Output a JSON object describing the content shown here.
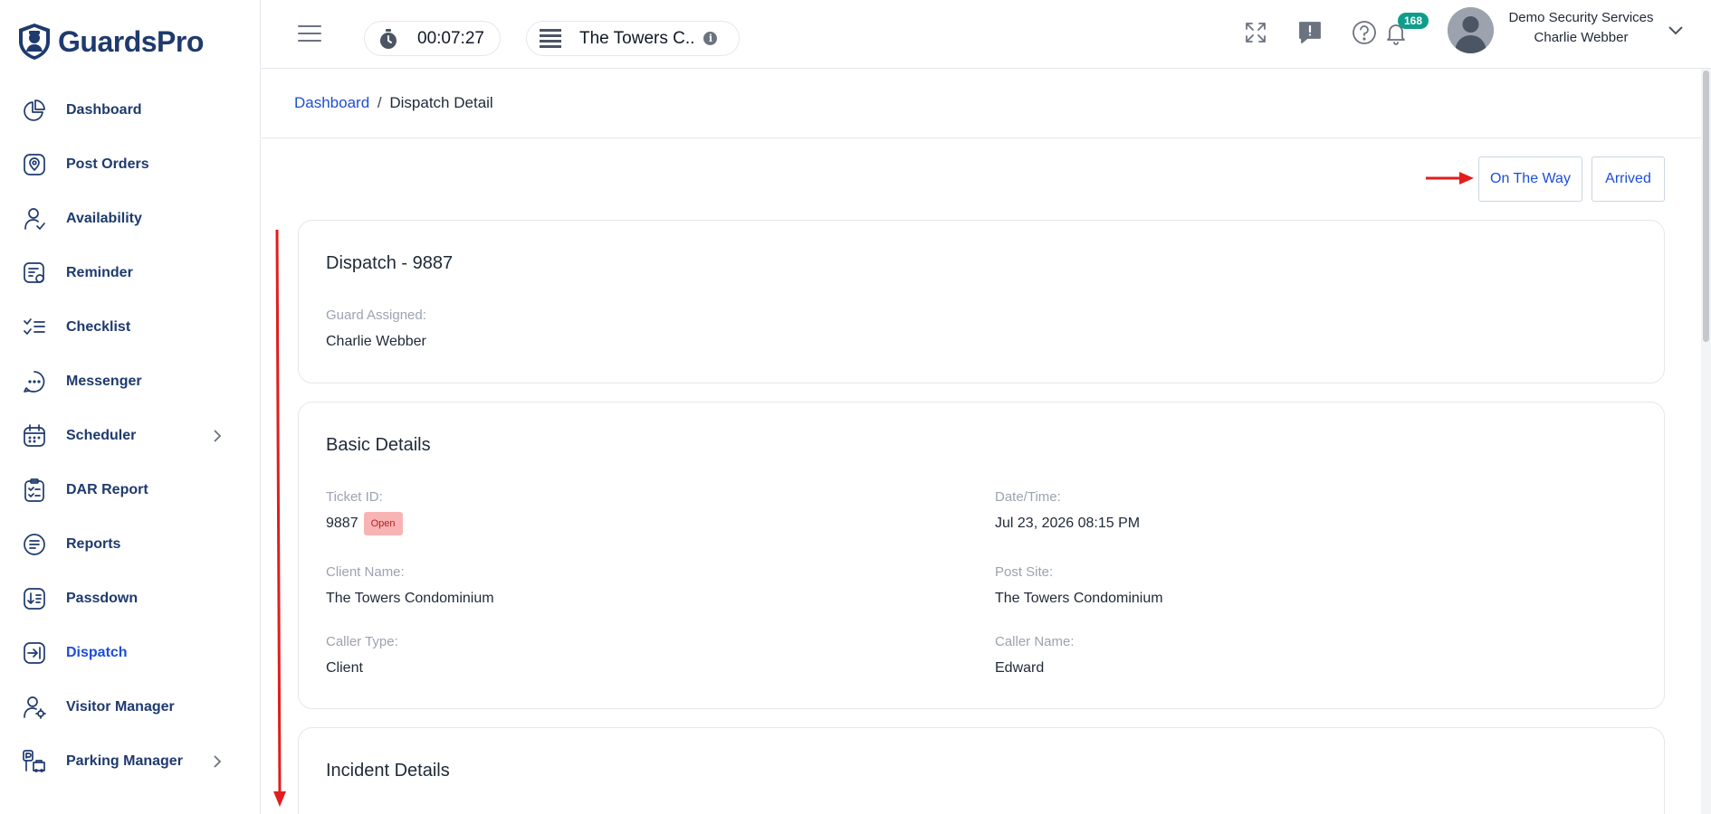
{
  "brand": {
    "name": "GuardsPro"
  },
  "sidebar": {
    "items": [
      {
        "label": "Dashboard",
        "icon": "pie-chart-icon",
        "active": false,
        "submenu": false
      },
      {
        "label": "Post Orders",
        "icon": "location-pin-icon",
        "active": false,
        "submenu": false
      },
      {
        "label": "Availability",
        "icon": "user-check-icon",
        "active": false,
        "submenu": false
      },
      {
        "label": "Reminder",
        "icon": "reminder-icon",
        "active": false,
        "submenu": false
      },
      {
        "label": "Checklist",
        "icon": "checklist-icon",
        "active": false,
        "submenu": false
      },
      {
        "label": "Messenger",
        "icon": "chat-icon",
        "active": false,
        "submenu": false
      },
      {
        "label": "Scheduler",
        "icon": "calendar-icon",
        "active": false,
        "submenu": true
      },
      {
        "label": "DAR Report",
        "icon": "clipboard-icon",
        "active": false,
        "submenu": false
      },
      {
        "label": "Reports",
        "icon": "report-icon",
        "active": false,
        "submenu": false
      },
      {
        "label": "Passdown",
        "icon": "passdown-icon",
        "active": false,
        "submenu": false
      },
      {
        "label": "Dispatch",
        "icon": "dispatch-icon",
        "active": true,
        "submenu": false
      },
      {
        "label": "Visitor Manager",
        "icon": "visitor-icon",
        "active": false,
        "submenu": false
      },
      {
        "label": "Parking Manager",
        "icon": "parking-icon",
        "active": false,
        "submenu": true
      }
    ]
  },
  "topbar": {
    "timer": "00:07:27",
    "site": "The Towers C..",
    "notifications_count": "168",
    "user_company": "Demo Security Services",
    "user_name": "Charlie Webber"
  },
  "breadcrumb": {
    "home": "Dashboard",
    "separator": "/",
    "current": "Dispatch Detail"
  },
  "actions": {
    "on_the_way": "On The Way",
    "arrived": "Arrived"
  },
  "dispatch_card": {
    "title": "Dispatch - 9887",
    "guard_label": "Guard Assigned:",
    "guard_value": "Charlie Webber"
  },
  "basic_details": {
    "title": "Basic Details",
    "ticket_id_label": "Ticket ID:",
    "ticket_id": "9887",
    "status": "Open",
    "datetime_label": "Date/Time:",
    "datetime": "Jul 23, 2026 08:15 PM",
    "client_name_label": "Client Name:",
    "client_name": "The Towers Condominium",
    "post_site_label": "Post Site:",
    "post_site": "The Towers Condominium",
    "caller_type_label": "Caller Type:",
    "caller_type": "Client",
    "caller_name_label": "Caller Name:",
    "caller_name": "Edward"
  },
  "incident_details": {
    "title": "Incident Details"
  },
  "colors": {
    "primary": "#1d4ed8",
    "brand": "#1e3a6e",
    "badge": "#0f9d8a",
    "status_open_bg": "#f8b4b4",
    "annotation": "#e11d1d"
  }
}
